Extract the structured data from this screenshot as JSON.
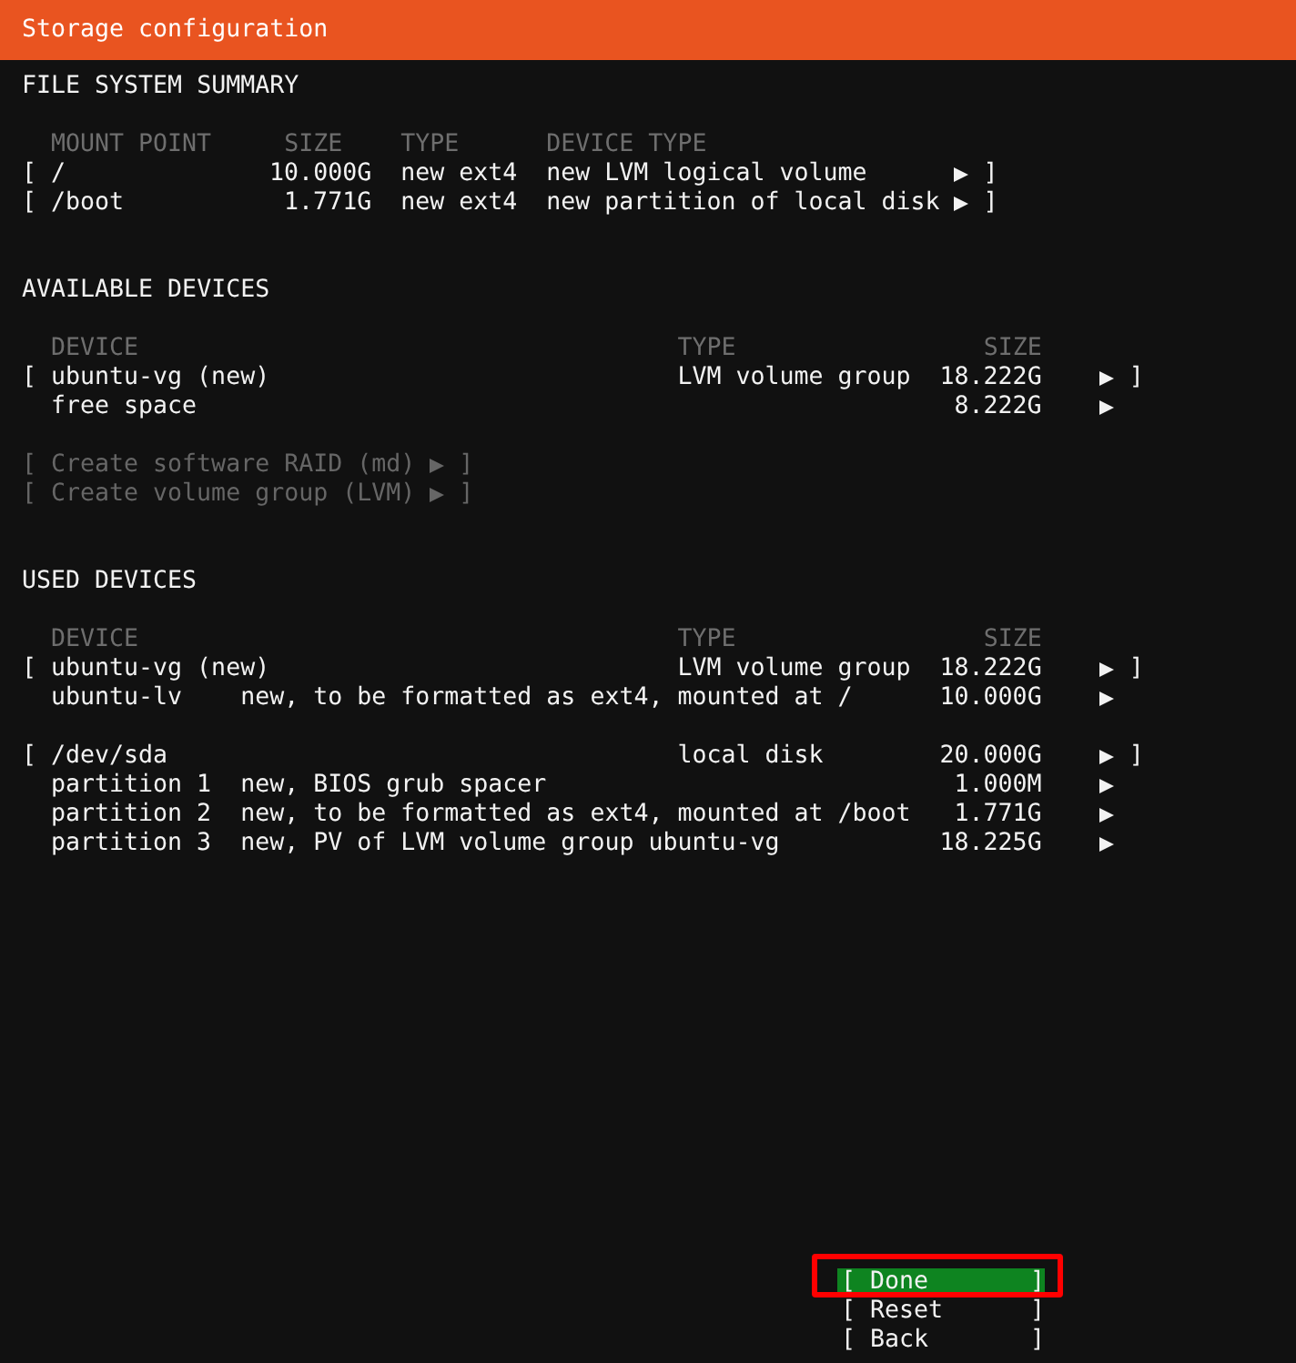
{
  "window": {
    "title": "Storage configuration"
  },
  "brackets": {
    "open": "[",
    "close": "]"
  },
  "file_system_summary": {
    "heading": "FILE SYSTEM SUMMARY",
    "columns": [
      "MOUNT POINT",
      "SIZE",
      "TYPE",
      "DEVICE TYPE"
    ],
    "rows": [
      {
        "framed": true,
        "mount_point": "/",
        "size": "10.000G",
        "type": "new ext4",
        "device_type": "new LVM logical volume"
      },
      {
        "framed": true,
        "mount_point": "/boot",
        "size": "1.771G",
        "type": "new ext4",
        "device_type": "new partition of local disk"
      }
    ]
  },
  "available_devices": {
    "heading": "AVAILABLE DEVICES",
    "columns": [
      "DEVICE",
      "TYPE",
      "SIZE"
    ],
    "rows": [
      {
        "framed": true,
        "device": "ubuntu-vg (new)",
        "type": "LVM volume group",
        "size": "18.222G"
      },
      {
        "framed": false,
        "device": "free space",
        "size": "8.222G"
      }
    ],
    "actions": [
      {
        "label": "Create software RAID (md)",
        "disabled": true
      },
      {
        "label": "Create volume group (LVM)",
        "disabled": true
      }
    ]
  },
  "used_devices": {
    "heading": "USED DEVICES",
    "columns": [
      "DEVICE",
      "TYPE",
      "SIZE"
    ],
    "groups": [
      [
        {
          "framed": true,
          "device": "ubuntu-vg (new)",
          "type": "LVM volume group",
          "size": "18.222G"
        },
        {
          "framed": false,
          "device": "ubuntu-lv",
          "detail": "new, to be formatted as ext4, mounted at /",
          "size": "10.000G"
        }
      ],
      [
        {
          "framed": true,
          "device": "/dev/sda",
          "type": "local disk",
          "size": "20.000G"
        },
        {
          "framed": false,
          "device": "partition 1",
          "detail": "new, BIOS grub spacer",
          "size": "1.000M"
        },
        {
          "framed": false,
          "device": "partition 2",
          "detail": "new, to be formatted as ext4, mounted at /boot",
          "size": "1.771G"
        },
        {
          "framed": false,
          "device": "partition 3",
          "detail": "new, PV of LVM volume group ubuntu-vg",
          "size": "18.225G"
        }
      ]
    ]
  },
  "buttons": [
    {
      "label": "Done",
      "selected": true,
      "highlighted": true
    },
    {
      "label": "Reset",
      "selected": false,
      "highlighted": false
    },
    {
      "label": "Back",
      "selected": false,
      "highlighted": false
    }
  ]
}
